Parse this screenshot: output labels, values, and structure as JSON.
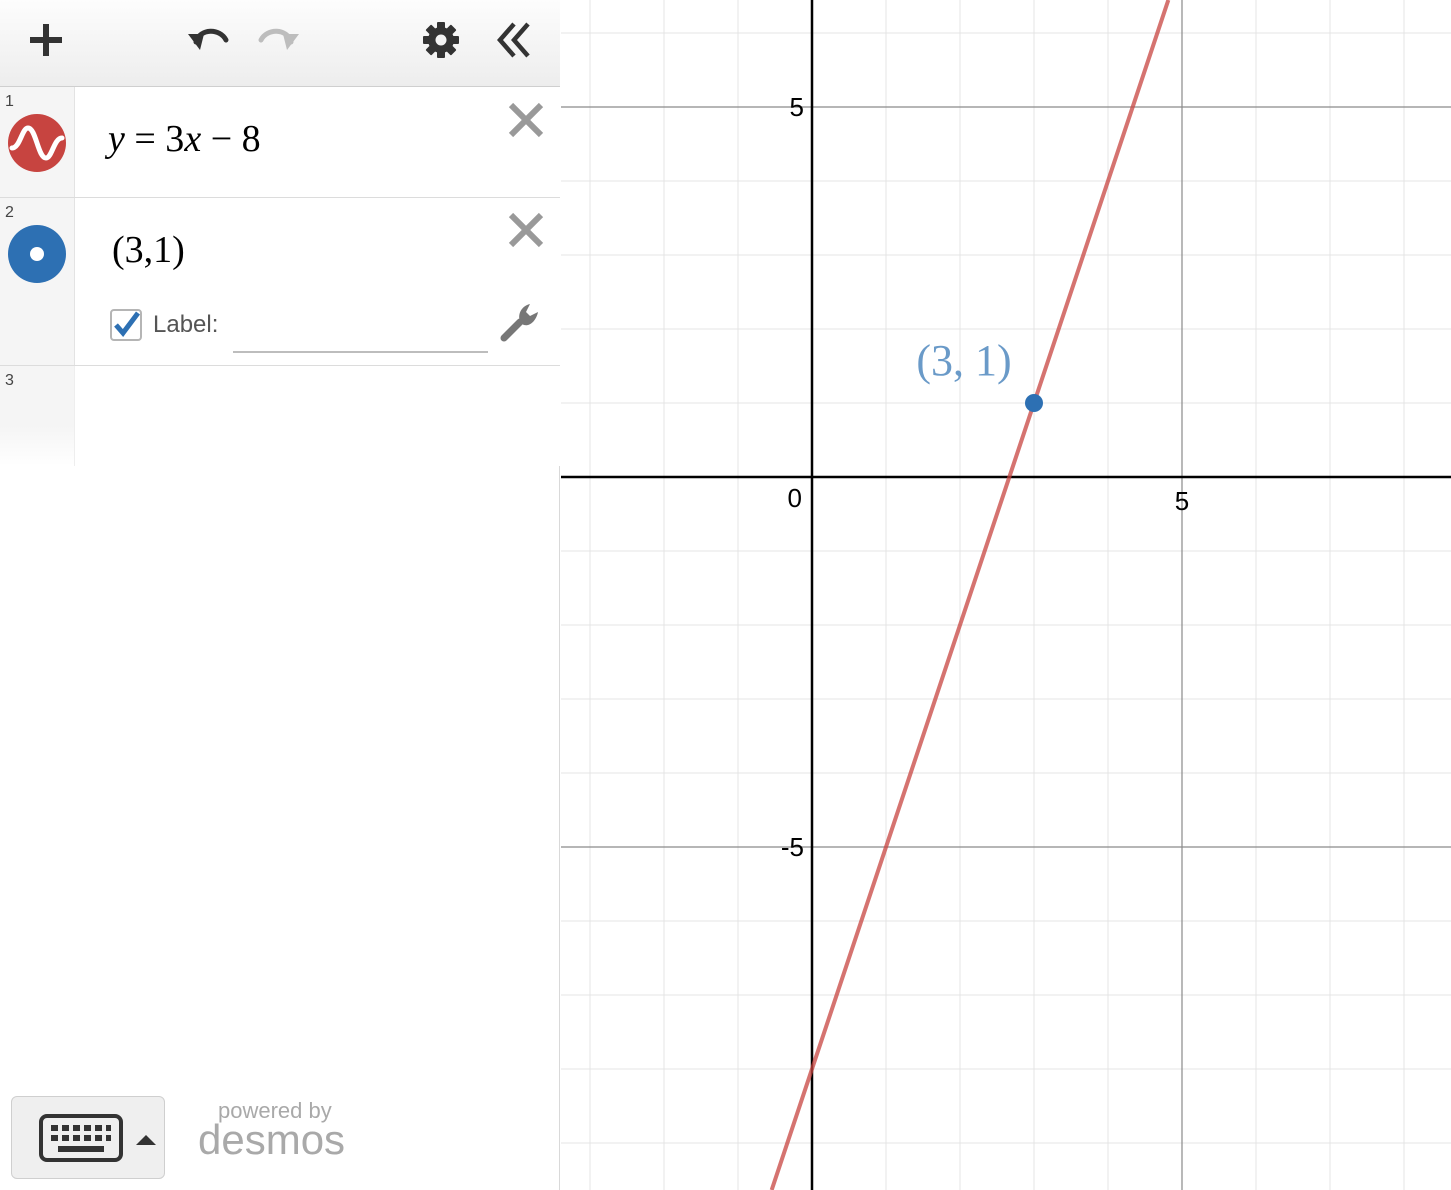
{
  "toolbar": {
    "add_icon": "plus-icon",
    "undo_icon": "undo-icon",
    "redo_icon": "redo-icon",
    "settings_icon": "gear-icon",
    "collapse_icon": "double-chevron-left-icon"
  },
  "expressions": [
    {
      "index": "1",
      "latex": "y = 3x − 8",
      "color": "#c74440",
      "icon": "sine-wave-icon"
    },
    {
      "index": "2",
      "latex": "(3,1)",
      "color": "#2d70b3",
      "icon": "point-icon",
      "label_checkbox": true,
      "label_text": "Label:",
      "label_value": ""
    },
    {
      "index": "3",
      "latex": ""
    }
  ],
  "footer": {
    "keyboard_icon": "keyboard-icon",
    "powered_by": "powered by",
    "brand": "desmos"
  },
  "graph": {
    "x_range": [
      -6.8,
      17.3
    ],
    "y_range": [
      -9.7,
      6.4
    ],
    "grid_step": 1,
    "major_step": 5,
    "x_tick_labels": [
      "5"
    ],
    "y_tick_labels": [
      "5",
      "-5"
    ],
    "origin_label": "0",
    "line": {
      "slope": 3,
      "intercept": -8,
      "color": "#c74440"
    },
    "point": {
      "x": 3,
      "y": 1,
      "label": "(3, 1)",
      "color": "#2d70b3",
      "label_color": "#6a9ac8"
    }
  }
}
